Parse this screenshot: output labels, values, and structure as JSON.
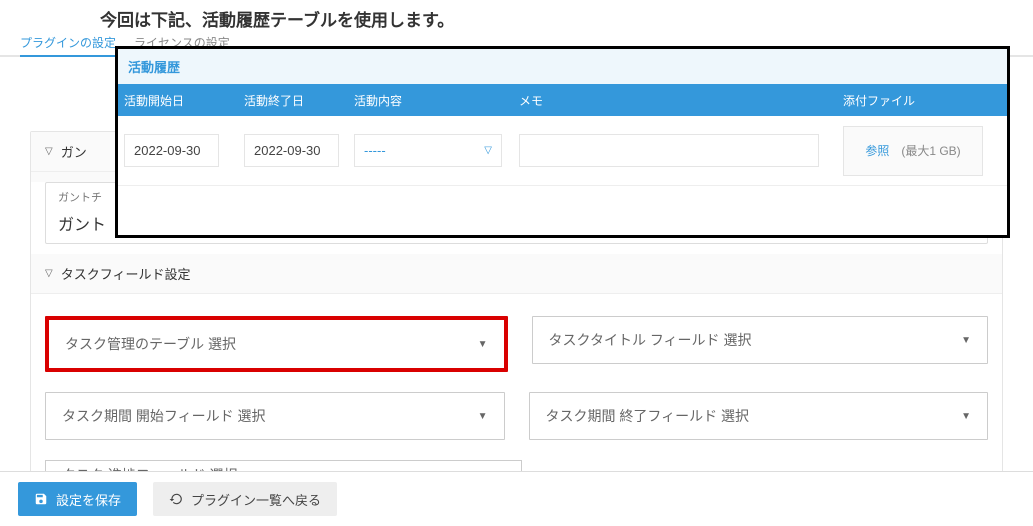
{
  "instruction": "今回は下記、活動履歴テーブルを使用します。",
  "tabs": {
    "plugin_settings": "プラグインの設定",
    "license_settings": "ライセンスの設定"
  },
  "overlay": {
    "title": "活動履歴",
    "headers": {
      "start": "活動開始日",
      "end": "活動終了日",
      "content": "活動内容",
      "memo": "メモ",
      "file": "添付ファイル"
    },
    "row": {
      "start": "2022-09-30",
      "end": "2022-09-30",
      "content": "-----",
      "memo": "",
      "file_browse": "参照",
      "file_hint": "(最大1 GB)"
    }
  },
  "sections": {
    "gantt": {
      "header": "ガン",
      "inner_label": "ガントチ",
      "inner_value": "ガント"
    },
    "task": {
      "header": "タスクフィールド設定",
      "selects": {
        "table": "タスク管理のテーブル 選択",
        "title": "タスクタイトル フィールド 選択",
        "start": "タスク期間 開始フィールド 選択",
        "end": "タスク期間 終了フィールド 選択",
        "partial": "タスク 進捗フィールド 選択"
      }
    }
  },
  "footer": {
    "save": "設定を保存",
    "back": "プラグイン一覧へ戻る"
  }
}
